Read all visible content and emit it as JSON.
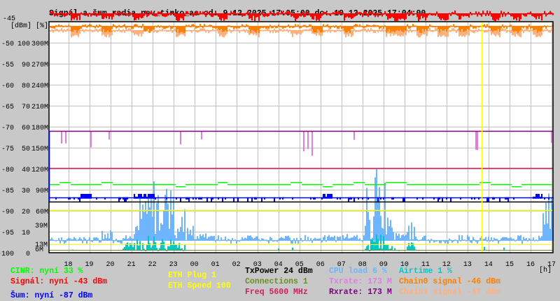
{
  "chart_data": {
    "type": "line",
    "title": "Signál a šum radia nev_tinko_ac od: 9.12.2025 17:05:00 do: 10.12.2025 17:04:00",
    "xlabel": "[h]",
    "ylabel": "[dBm] [%]",
    "x_ticks": [
      "18",
      "19",
      "20",
      "21",
      "22",
      "23",
      "00",
      "01",
      "02",
      "03",
      "04",
      "05",
      "06",
      "07",
      "08",
      "09",
      "10",
      "11",
      "12",
      "13",
      "14",
      "15",
      "16",
      "17"
    ],
    "x_range_hours": [
      17.083,
      41.067
    ],
    "y_ticks_dbm": [
      "-45",
      "-50",
      "-55",
      "-60",
      "-65",
      "-70",
      "-75",
      "-80",
      "-85",
      "-90",
      "-95",
      "-100"
    ],
    "y_ticks_pct": [
      "",
      "100",
      "90",
      "80",
      "70",
      "60",
      "50",
      "40",
      "30",
      "20",
      "10",
      "0"
    ],
    "y_ticks_rate": [
      "",
      "300M",
      "270M",
      "240M",
      "210M",
      "180M",
      "150M",
      "120M",
      "90M",
      "60M",
      "",
      ""
    ],
    "y_range_dbm": [
      -100,
      -45
    ],
    "rate_markers": {
      "tx_max": "39M",
      "tx_min": "13M",
      "rx_min": "6M"
    },
    "grid": true,
    "sample_interval_min": 30,
    "series": [
      {
        "name": "Signál",
        "unit": "dBm",
        "color": "#ff0000",
        "values": [
          -43,
          -43,
          -44,
          -43,
          -43,
          -44,
          -43,
          -43,
          -44,
          -43,
          -43,
          -43,
          -44,
          -43,
          -43,
          -43,
          -44,
          -43,
          -43,
          -44,
          -43,
          -43,
          -43,
          -44,
          -43,
          -44,
          -43,
          -43,
          -44,
          -43,
          -43,
          -43,
          -44,
          -44,
          -43,
          -44,
          -43,
          -44,
          -43,
          -44,
          -43,
          -43,
          -44,
          -43,
          -44,
          -43,
          -44,
          -43
        ]
      },
      {
        "name": "Chain0 signal",
        "unit": "dBm",
        "color": "#ff7f00",
        "values": [
          -46,
          -46,
          -47,
          -46,
          -46,
          -47,
          -46,
          -46,
          -46,
          -47,
          -46,
          -46,
          -47,
          -46,
          -46,
          -46,
          -47,
          -46,
          -46,
          -47,
          -46,
          -46,
          -46,
          -46,
          -46,
          -47,
          -46,
          -46,
          -47,
          -46,
          -46,
          -46,
          -47,
          -47,
          -46,
          -47,
          -46,
          -47,
          -46,
          -47,
          -46,
          -46,
          -47,
          -46,
          -47,
          -46,
          -47,
          -46
        ]
      },
      {
        "name": "Chain1 signal",
        "unit": "dBm",
        "color": "#ffb07f",
        "values": [
          -47,
          -47,
          -48,
          -47,
          -47,
          -48,
          -47,
          -47,
          -48,
          -47,
          -47,
          -47,
          -48,
          -47,
          -47,
          -47,
          -48,
          -47,
          -47,
          -48,
          -47,
          -47,
          -47,
          -48,
          -47,
          -48,
          -47,
          -47,
          -48,
          -47,
          -47,
          -47,
          -48,
          -48,
          -47,
          -48,
          -47,
          -48,
          -47,
          -48,
          -47,
          -47,
          -48,
          -47,
          -48,
          -47,
          -48,
          -47
        ]
      },
      {
        "name": "Šum",
        "unit": "dBm",
        "color": "#0000ff",
        "values": [
          -87,
          -87,
          -87,
          -86,
          -87,
          -87,
          -87,
          -87,
          -86,
          -86,
          -87,
          -87,
          -87,
          -87,
          -87,
          -87,
          -87,
          -87,
          -87,
          -87,
          -87,
          -87,
          -87,
          -87,
          -87,
          -87,
          -86,
          -87,
          -87,
          -87,
          -87,
          -87,
          -87,
          -87,
          -87,
          -87,
          -87,
          -87,
          -87,
          -87,
          -87,
          -87,
          -87,
          -87,
          -87,
          -87,
          -86,
          -87
        ]
      },
      {
        "name": "CINR",
        "unit": "%",
        "color": "#00ff00",
        "values": [
          33,
          34,
          33,
          33,
          33,
          34,
          33,
          33,
          33,
          33,
          33,
          33,
          32,
          33,
          33,
          33,
          34,
          33,
          33,
          33,
          33,
          33,
          33,
          34,
          33,
          33,
          32,
          33,
          33,
          34,
          33,
          33,
          34,
          34,
          33,
          33,
          33,
          33,
          33,
          33,
          33,
          34,
          33,
          33,
          32,
          33,
          33,
          33
        ]
      },
      {
        "name": "CPU load",
        "unit": "%",
        "color": "#6eb4ff",
        "values": [
          6,
          6,
          7,
          6,
          6,
          10,
          6,
          7,
          25,
          35,
          30,
          28,
          20,
          12,
          8,
          7,
          7,
          6,
          7,
          7,
          6,
          7,
          7,
          6,
          7,
          6,
          7,
          7,
          8,
          7,
          30,
          40,
          15,
          9,
          20,
          7,
          6,
          6,
          6,
          7,
          6,
          7,
          6,
          6,
          7,
          6,
          7,
          30
        ]
      },
      {
        "name": "Airtime",
        "unit": "%",
        "color": "#00c8c8",
        "values": [
          1,
          1,
          1,
          1,
          1,
          1,
          1,
          2,
          3,
          4,
          3,
          3,
          2,
          1,
          1,
          1,
          1,
          1,
          1,
          1,
          1,
          1,
          1,
          1,
          1,
          1,
          1,
          1,
          1,
          1,
          3,
          4,
          2,
          1,
          2,
          1,
          1,
          1,
          1,
          1,
          1,
          1,
          1,
          1,
          1,
          1,
          1,
          1
        ]
      },
      {
        "name": "Txrate",
        "unit": "M",
        "color": "#e07ee0",
        "values": [
          173,
          160,
          173,
          150,
          173,
          160,
          173,
          173,
          150,
          173,
          173,
          173,
          160,
          173,
          160,
          173,
          173,
          173,
          173,
          173,
          173,
          173,
          173,
          173,
          150,
          140,
          173,
          173,
          150,
          160,
          173,
          173,
          173,
          173,
          173,
          173,
          173,
          173,
          173,
          173,
          150,
          173,
          173,
          173,
          173,
          173,
          173,
          160
        ]
      },
      {
        "name": "Rxrate",
        "unit": "M",
        "color": "#7f007f",
        "values": [
          173,
          173,
          173,
          173,
          173,
          173,
          173,
          173,
          173,
          173,
          173,
          173,
          173,
          173,
          173,
          173,
          173,
          173,
          173,
          173,
          173,
          173,
          173,
          173,
          173,
          173,
          173,
          173,
          173,
          173,
          173,
          173,
          173,
          173,
          173,
          173,
          173,
          173,
          173,
          173,
          173,
          173,
          173,
          173,
          173,
          173,
          173,
          173
        ]
      }
    ],
    "eth_unplug_time": "13:41"
  },
  "legend": {
    "cinr": "CINR: nyní 33 %",
    "signal": "Signál: nyní -43 dBm",
    "noise": "Šum: nyní -87 dBm",
    "eth_plug": "ETH Plug 1",
    "eth_speed": "ETH Speed 100",
    "txpower": "TxPower 24 dBm",
    "connections": "Connections 1",
    "freq": "Freq 5600 MHz",
    "cpu": "CPU load 6 %",
    "txrate": "Txrate: 173 M",
    "rxrate": "Rxrate: 173 M",
    "airtime": "Airtime 1 %",
    "chain0": "Chain0 signal -46 dBm",
    "chain1": "Chain1 signal -47 dBm"
  },
  "colors": {
    "signal": "#ff0000",
    "chain0": "#ff7f00",
    "chain1": "#ffb07f",
    "noise": "#0000ff",
    "cinr": "#00ff00",
    "cpu": "#6eb4ff",
    "airtime": "#00c8c8",
    "txrate": "#e07ee0",
    "rxrate": "#7f007f",
    "freq": "#d02060",
    "eth": "#ffff00",
    "connections": "#6b8e23",
    "txpower": "#000000"
  }
}
